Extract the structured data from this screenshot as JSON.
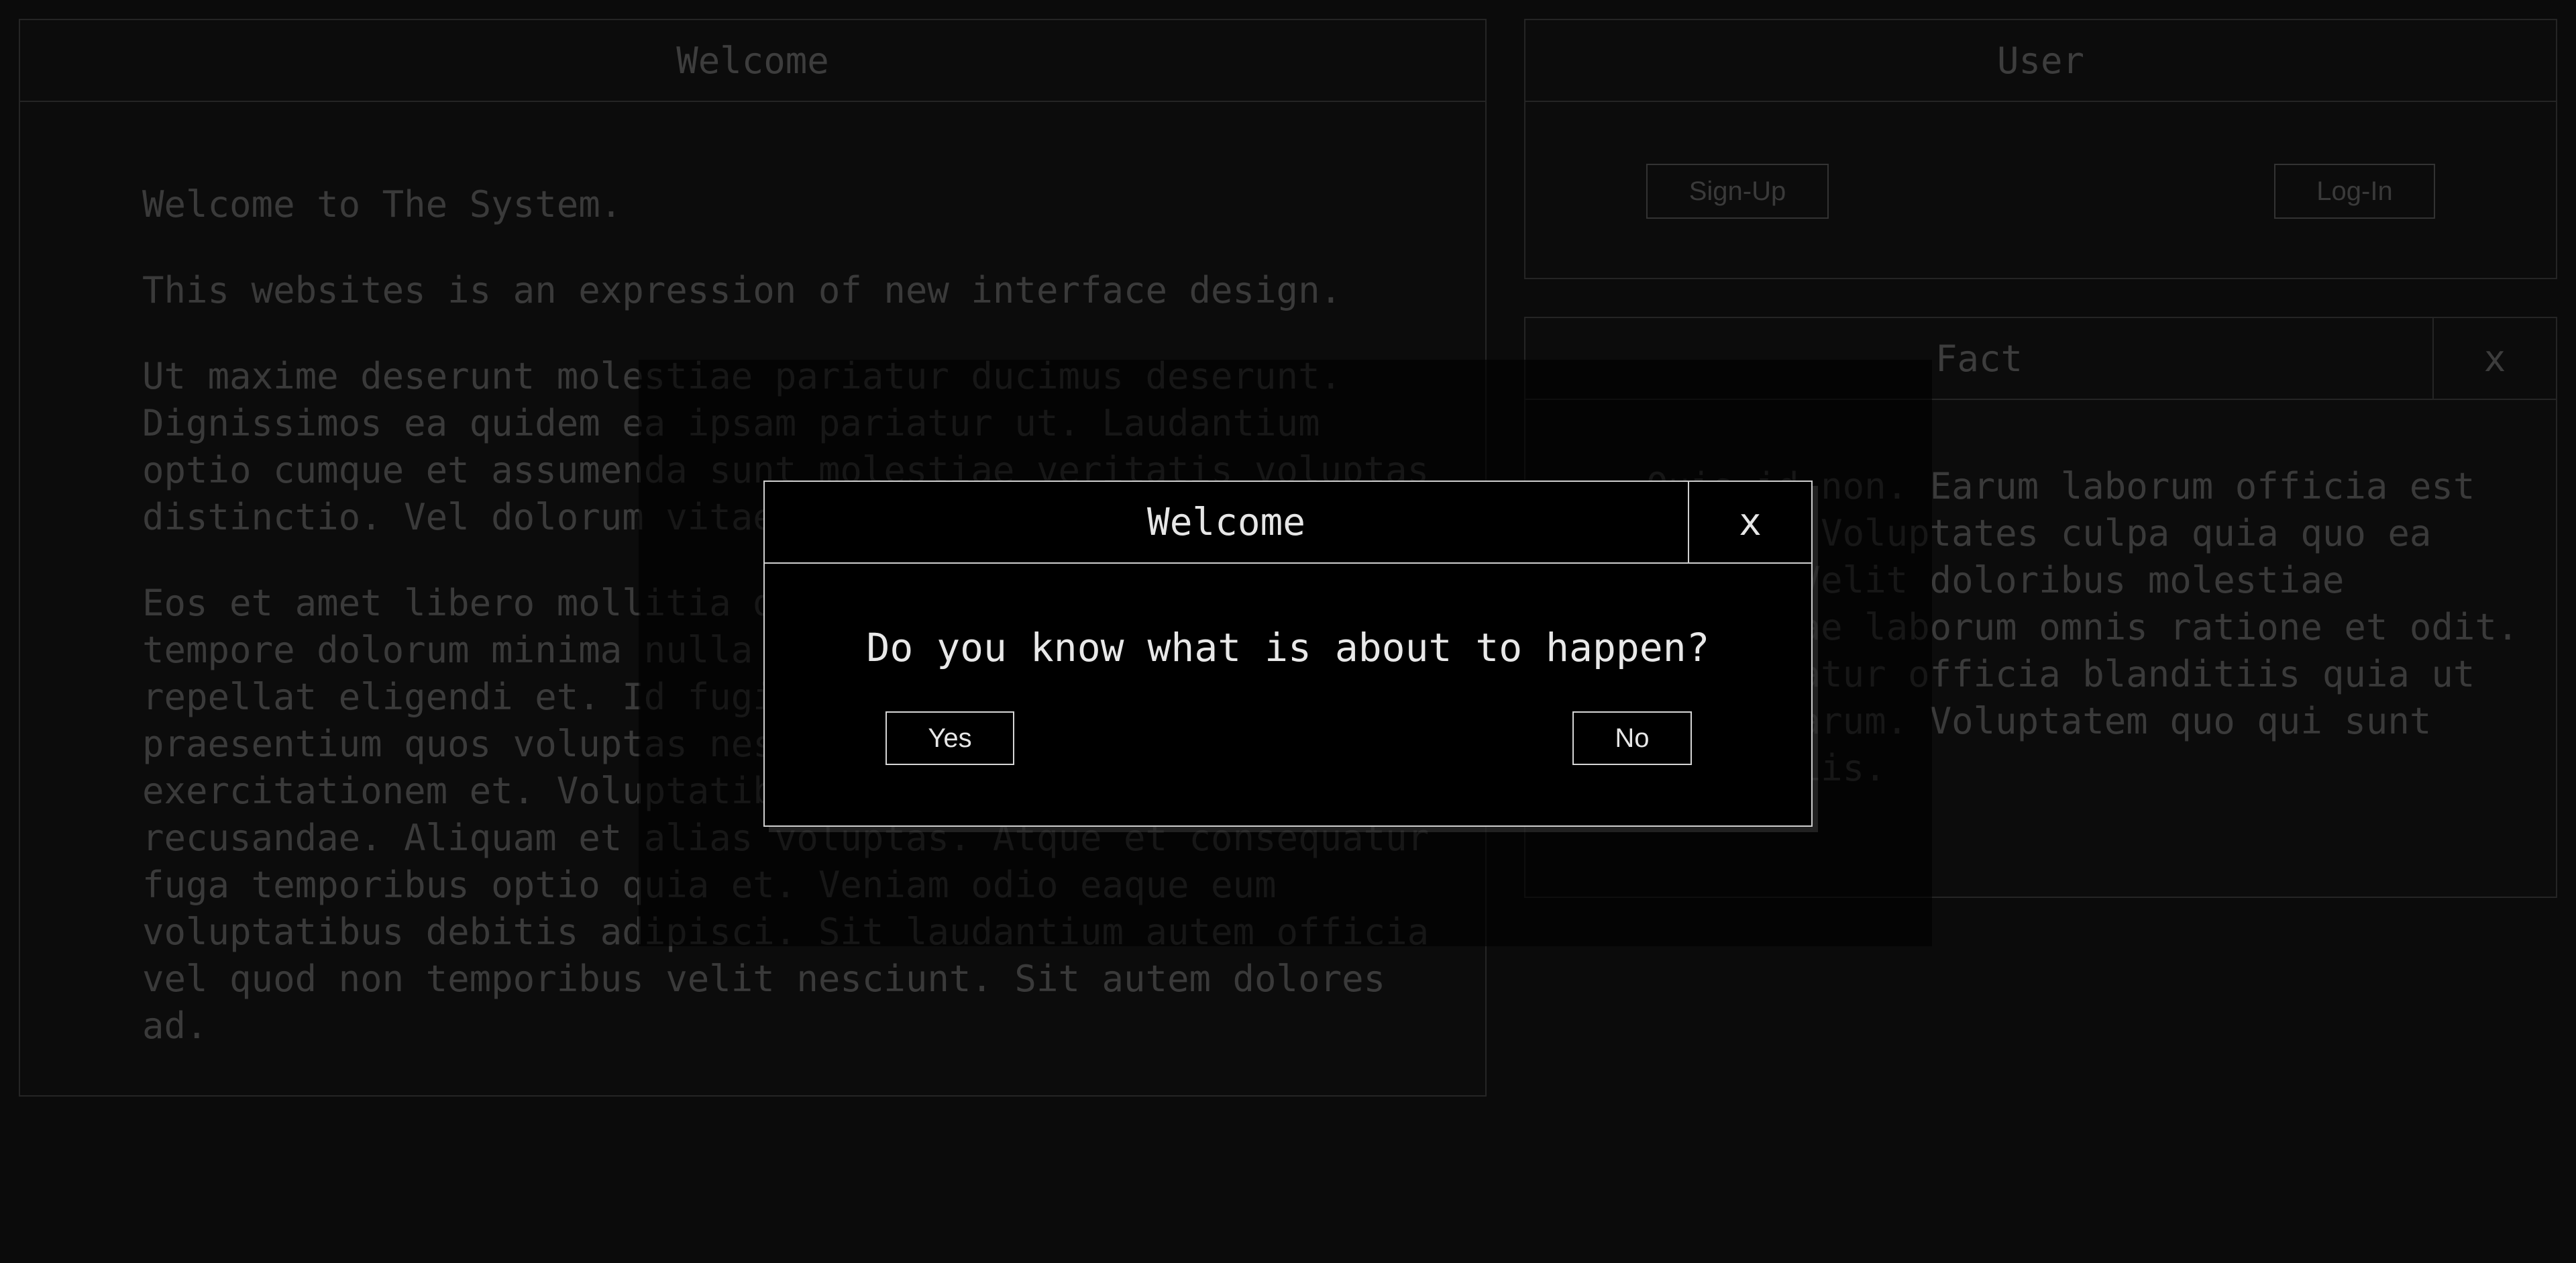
{
  "welcome_panel": {
    "title": "Welcome",
    "paragraphs": [
      "Welcome to The System.",
      "This websites is an expression of new interface design.",
      "Ut maxime deserunt molestiae pariatur ducimus deserunt. Dignissimos ea quidem ea ipsam pariatur ut. Laudantium optio cumque et assumenda sunt molestiae veritatis voluptas distinctio. Vel dolorum vitae.",
      "Eos et amet libero mollitia deleniti est. Illum ipsum tempore dolorum minima nulla odit et aut maiores. Eum rerum repellat eligendi et. Id fugiat consequatur qui illo. Quo praesentium quos voluptas nesciunt. Voluptatibus exercitationem et. Voluptatibus qui esse blanditiis sunt recusandae. Aliquam et alias voluptas. Atque et consequatur fuga temporibus optio quia et. Veniam odio eaque eum voluptatibus debitis adipisci. Sit laudantium autem officia vel quod non temporibus velit nesciunt. Sit autem dolores ad."
    ]
  },
  "user_panel": {
    "title": "User",
    "signup_label": "Sign-Up",
    "login_label": "Log-In"
  },
  "fact_panel": {
    "title": "Fact",
    "close_label": "x",
    "text": "Quis id non. Earum laborum officia est dolore. Voluptates culpa quia quo ea vitae. Velit doloribus molestiae molestiae laborum omnis ratione et odit. Consequatur officia blanditiis quia ut nobis earum. Voluptatem quo qui sunt blanditiis."
  },
  "modal": {
    "title": "Welcome",
    "close_label": "x",
    "question": "Do you know what is about to happen?",
    "yes_label": "Yes",
    "no_label": "No"
  },
  "colors": {
    "background": "#0b0b0b",
    "panel_border": "#252525",
    "dim_text": "#3a3a3a",
    "modal_border": "#cfcfcf",
    "modal_text": "#e6e6e6"
  }
}
